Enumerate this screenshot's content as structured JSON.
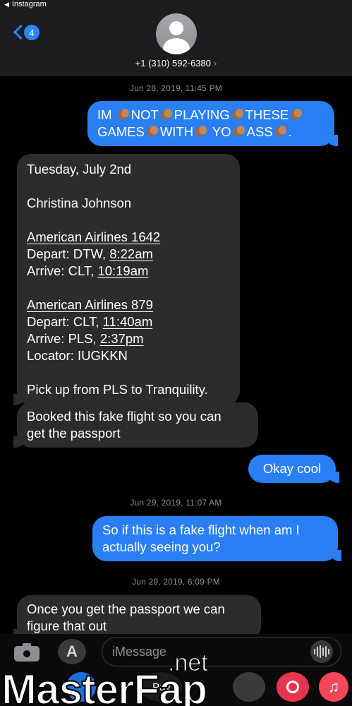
{
  "status": {
    "back_app": "Instagram"
  },
  "header": {
    "badge_count": "4",
    "contact": "+1 (310) 592-6380",
    "contact_arrow": "›"
  },
  "timestamps": [
    "Jun 28, 2019, 11:45 PM",
    "Jun 29, 2019, 11:07 AM",
    "Jun 29, 2019, 6:09 PM"
  ],
  "messages": {
    "m1": {
      "w": [
        "IM",
        "NOT",
        "PLAYING",
        "THESE",
        "GAMES",
        "WITH",
        "YO",
        "ASS",
        "."
      ]
    },
    "m2": {
      "date": "Tuesday, July 2nd",
      "name": "Christina Johnson",
      "f1_flight": "American Airlines 1642",
      "f1_depart_pre": "Depart: DTW, ",
      "f1_depart_time": "8:22am",
      "f1_arrive_pre": "Arrive: CLT, ",
      "f1_arrive_time": "10:19am",
      "f2_flight": "American Airlines 879",
      "f2_depart_pre": "Depart: CLT, ",
      "f2_depart_time": "11:40am",
      "f2_arrive_pre": "Arrive: PLS, ",
      "f2_arrive_time": "2:37pm",
      "locator": "Locator: IUGKKN",
      "pickup": "Pick up from PLS to Tranquility."
    },
    "m3": {
      "l1": "Booked this fake flight so you can",
      "l2": "get the passport"
    },
    "m4": {
      "text": "Okay cool"
    },
    "m5": {
      "l1": "So if this is a fake flight when am I",
      "l2": "actually seeing you?"
    },
    "m6": {
      "l1": "Once you get the passport we can",
      "l2": "figure that out"
    }
  },
  "composer": {
    "placeholder": "iMessage",
    "pay_label": "Pay"
  },
  "watermark": {
    "main": "MasterFap",
    "net": ".net"
  },
  "colors": {
    "sent": "#2a7ff4",
    "received": "#2c2c2e",
    "accent": "#2a85ff"
  }
}
